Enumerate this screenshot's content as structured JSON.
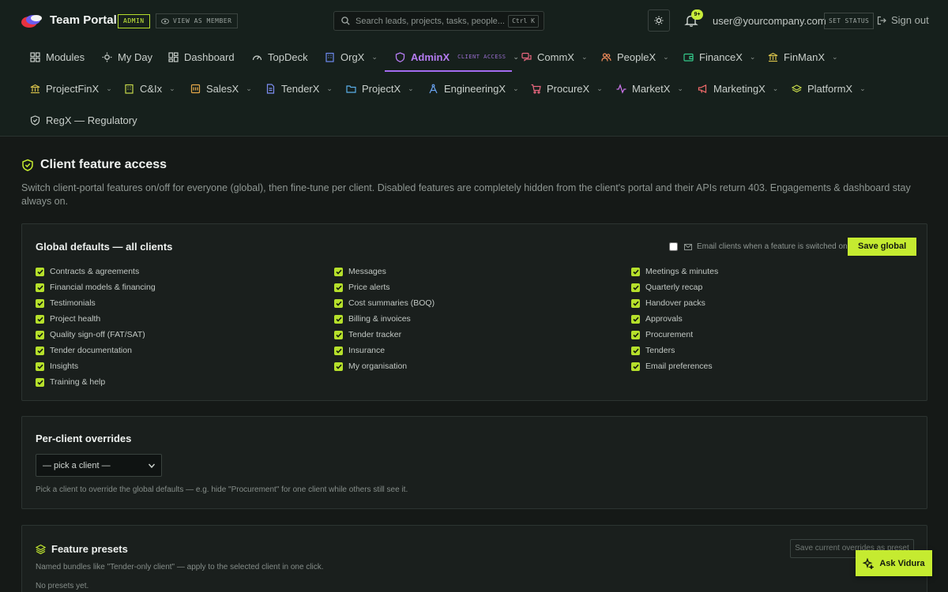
{
  "app": {
    "brand": "Team Portal",
    "admin_badge": "ADMIN",
    "view_as_member": "VIEW AS MEMBER",
    "search_placeholder": "Search leads, projects, tasks, people...",
    "search_shortcut": "Ctrl K",
    "notifications_count": "9+",
    "user_email": "user@yourcompany.com",
    "set_status": "SET STATUS",
    "sign_out": "Sign out",
    "accent_color": "#c5eb30",
    "active_tab_color": "#a36cf0"
  },
  "nav": {
    "row1": [
      {
        "label": "Modules",
        "icon": "grid-icon"
      },
      {
        "label": "My Day",
        "icon": "sun-icon"
      },
      {
        "label": "Dashboard",
        "icon": "dashboard-icon"
      },
      {
        "label": "TopDeck",
        "icon": "gauge-icon"
      },
      {
        "label": "OrgX",
        "icon": "building-icon"
      },
      {
        "label": "AdminX",
        "sub": "CLIENT ACCESS",
        "icon": "shield-icon"
      },
      {
        "label": "CommX",
        "icon": "chat-icon"
      },
      {
        "label": "PeopleX",
        "icon": "people-icon"
      },
      {
        "label": "FinanceX",
        "icon": "wallet-icon"
      },
      {
        "label": "FinManX",
        "icon": "bank-icon"
      }
    ],
    "row2": [
      {
        "label": "ProjectFinX",
        "icon": "bank-icon"
      },
      {
        "label": "C&Ix",
        "icon": "building-icon"
      },
      {
        "label": "SalesX",
        "icon": "tag-icon"
      },
      {
        "label": "TenderX",
        "icon": "document-icon"
      },
      {
        "label": "ProjectX",
        "icon": "folder-icon"
      },
      {
        "label": "EngineeringX",
        "icon": "compass-icon"
      },
      {
        "label": "ProcureX",
        "icon": "cart-icon"
      },
      {
        "label": "MarketX",
        "icon": "pulse-icon"
      },
      {
        "label": "MarketingX",
        "icon": "megaphone-icon"
      },
      {
        "label": "PlatformX",
        "icon": "layers-icon"
      }
    ],
    "row3": [
      {
        "label": "RegX — Regulatory",
        "icon": "shield-icon"
      }
    ]
  },
  "page": {
    "title": "Client feature access",
    "description": "Switch client-portal features on/off for everyone (global), then fine-tune per client. Disabled features are completely hidden from the client's portal and their APIs return 403. Engagements & dashboard stay always on."
  },
  "global_defaults": {
    "title": "Global defaults — all clients",
    "email_toggle_label": "Email clients when a feature is switched on",
    "save_label": "Save global",
    "columns": [
      [
        "Contracts & agreements",
        "Financial models & financing",
        "Testimonials",
        "Project health",
        "Quality sign-off (FAT/SAT)",
        "Tender documentation",
        "Insights",
        "Training & help"
      ],
      [
        "Messages",
        "Price alerts",
        "Cost summaries (BOQ)",
        "Billing & invoices",
        "Tender tracker",
        "Insurance",
        "My organisation"
      ],
      [
        "Meetings & minutes",
        "Quarterly recap",
        "Handover packs",
        "Approvals",
        "Procurement",
        "Tenders",
        "Email preferences"
      ]
    ]
  },
  "overrides": {
    "title": "Per-client overrides",
    "select_value": "— pick a client —",
    "hint": "Pick a client to override the global defaults — e.g. hide \"Procurement\" for one client while others still see it."
  },
  "presets": {
    "title": "Feature presets",
    "description": "Named bundles like \"Tender-only client\" — apply to the selected client in one click.",
    "empty": "No presets yet.",
    "save_preset_label": "Save current overrides as preset"
  },
  "assistant": {
    "label": "Ask Vidura"
  }
}
